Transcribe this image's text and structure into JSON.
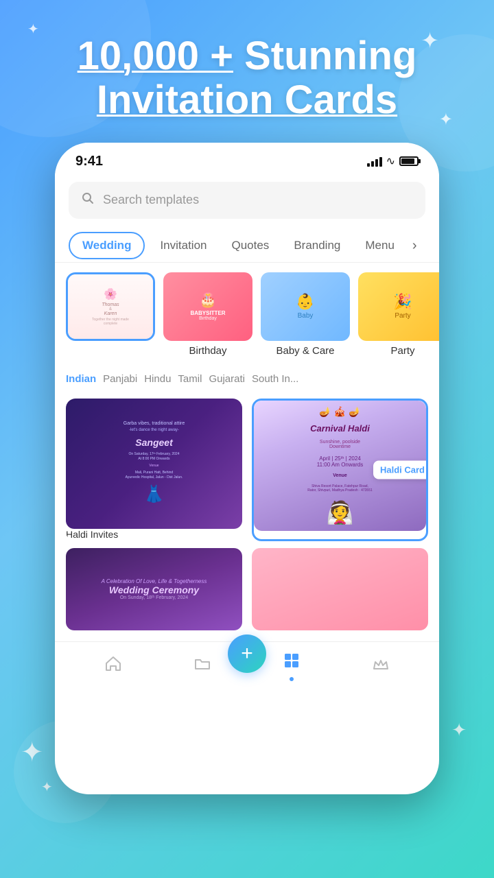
{
  "hero": {
    "title_line1": "10,000 + Stunning",
    "title_line2": "Invitation Cards",
    "highlight": "10,000 +"
  },
  "status_bar": {
    "time": "9:41",
    "signal": "signal",
    "wifi": "wifi",
    "battery": "battery"
  },
  "search": {
    "placeholder": "Search templates"
  },
  "tabs": {
    "items": [
      {
        "id": "wedding",
        "label": "Wedding",
        "active": true
      },
      {
        "id": "invitation",
        "label": "Invitation",
        "active": false
      },
      {
        "id": "quotes",
        "label": "Quotes",
        "active": false
      },
      {
        "id": "branding",
        "label": "Branding",
        "active": false
      },
      {
        "id": "menu",
        "label": "Menu",
        "active": false
      }
    ],
    "more_label": "›"
  },
  "template_categories": [
    {
      "id": "wedding",
      "label": "",
      "selected": true
    },
    {
      "id": "birthday",
      "label": "Birthday",
      "selected": false
    },
    {
      "id": "baby_care",
      "label": "Baby & Care",
      "selected": false
    },
    {
      "id": "party",
      "label": "Party",
      "selected": false
    }
  ],
  "region_tabs": [
    {
      "id": "indian",
      "label": "Indian",
      "active": true
    },
    {
      "id": "panjabi",
      "label": "Panjabi",
      "active": false
    },
    {
      "id": "hindu",
      "label": "Hindu",
      "active": false
    },
    {
      "id": "tamil",
      "label": "Tamil",
      "active": false
    },
    {
      "id": "gujarati",
      "label": "Gujarati",
      "active": false
    },
    {
      "id": "south_indian",
      "label": "South In...",
      "active": false
    }
  ],
  "cards": [
    {
      "id": "haldi_invites",
      "label": "Haldi Invites",
      "highlighted": false
    },
    {
      "id": "carnival_haldi",
      "label": "Haldi Card",
      "highlighted": true,
      "badge": "Haldi Card"
    }
  ],
  "bottom_nav": {
    "items": [
      {
        "id": "home",
        "label": "home",
        "icon": "⌂",
        "active": false
      },
      {
        "id": "folder",
        "label": "folder",
        "icon": "⊟",
        "active": false
      },
      {
        "id": "grid",
        "label": "grid",
        "icon": "⊞",
        "active": true
      },
      {
        "id": "crown",
        "label": "crown",
        "icon": "♛",
        "active": false
      }
    ],
    "fab_label": "+"
  }
}
